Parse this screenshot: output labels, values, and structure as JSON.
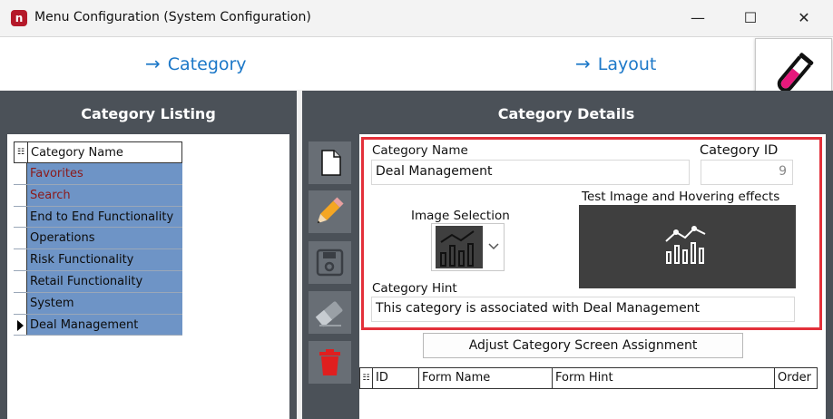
{
  "window": {
    "title": "Menu Configuration (System Configuration)",
    "app_icon": "n",
    "controls": {
      "minimize": "—",
      "maximize": "☐",
      "close": "✕"
    }
  },
  "nav": {
    "arrow": "→",
    "category": "Category",
    "layout": "Layout",
    "flask_icon": "test-tube-icon",
    "accent_color": "#1c78c8"
  },
  "left_panel": {
    "title": "Category Listing",
    "grid": {
      "header": "Category Name",
      "rows": [
        {
          "label": "Favorites",
          "color": "#8b1a1a"
        },
        {
          "label": "Search",
          "color": "#8b1a1a"
        },
        {
          "label": "End to End Functionality"
        },
        {
          "label": "Operations"
        },
        {
          "label": "Risk Functionality"
        },
        {
          "label": "Retail Functionality"
        },
        {
          "label": "System"
        },
        {
          "label": "Deal Management",
          "current": true
        }
      ],
      "row_color": "#6e94c6"
    }
  },
  "right_panel": {
    "title": "Category Details",
    "toolbar": [
      "new-document-icon",
      "pencil-icon",
      "save-disk-icon",
      "eraser-icon",
      "trash-icon"
    ],
    "form": {
      "category_name_label": "Category Name",
      "category_name_value": "Deal Management",
      "category_id_label": "Category ID",
      "category_id_value": "9",
      "image_selection_label": "Image Selection",
      "test_image_label": "Test Image and Hovering effects",
      "category_hint_label": "Category Hint",
      "category_hint_value": "This category is associated with Deal Management",
      "highlight_color": "#e3303a"
    },
    "adjust_button": "Adjust Category Screen Assignment",
    "forms_grid": {
      "columns": [
        "ID",
        "Form Name",
        "Form Hint",
        "Order"
      ]
    }
  }
}
